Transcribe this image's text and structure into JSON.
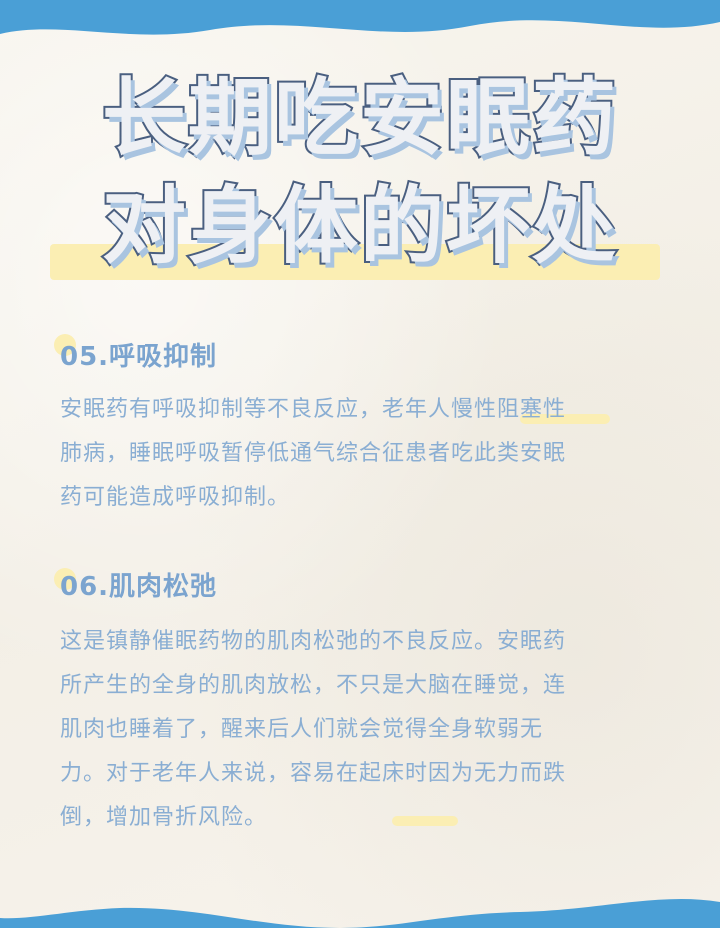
{
  "title": {
    "line1": "长期吃安眠药",
    "line2": "对身体的坏处"
  },
  "sections": [
    {
      "heading": "05.呼吸抑制",
      "lines": [
        "安眠药有呼吸抑制等不良反应，老年人慢性阻塞性",
        "肺病，睡眠呼吸暂停低通气综合征患者吃此类安眠",
        "药可能造成呼吸抑制。"
      ]
    },
    {
      "heading": "06.肌肉松弛",
      "lines": [
        "这是镇静催眠药物的肌肉松弛的不良反应。安眠药",
        "所产生的全身的肌肉放松，不只是大脑在睡觉，连",
        "肌肉也睡着了，醒来后人们就会觉得全身软弱无",
        "力。对于老年人来说，容易在起床时因为无力而跌",
        "倒，增加骨折风险。"
      ]
    }
  ],
  "colors": {
    "wave_blue": "#4a9fd6",
    "title_stroke": "#4a5f80",
    "title_shadow": "#a9c4e0",
    "heading_text": "#7ba4cf",
    "body_text": "#8aaed3",
    "highlight_yellow": "#fbeeb3",
    "background": "#f6f2ea"
  }
}
